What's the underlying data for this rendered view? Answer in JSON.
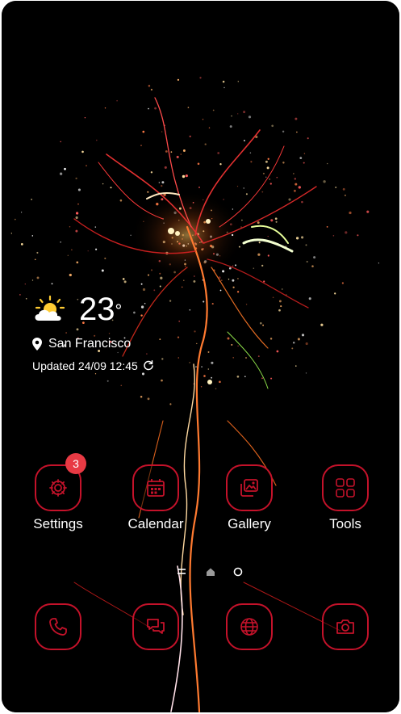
{
  "weather": {
    "temperature": "23",
    "degree_symbol": "°",
    "location": "San Francisco",
    "updated": "Updated 24/09 12:45",
    "icon": "partly-sunny-icon"
  },
  "apps": [
    {
      "label": "Settings",
      "icon": "gear-icon",
      "badge": "3"
    },
    {
      "label": "Calendar",
      "icon": "calendar-icon"
    },
    {
      "label": "Gallery",
      "icon": "gallery-icon"
    },
    {
      "label": "Tools",
      "icon": "tools-folder-icon"
    }
  ],
  "dock": [
    {
      "icon": "phone-icon"
    },
    {
      "icon": "messages-icon"
    },
    {
      "icon": "browser-icon"
    },
    {
      "icon": "camera-icon"
    }
  ],
  "page_indicators": [
    "menu-indicator",
    "home-indicator",
    "page-dot-indicator"
  ],
  "colors": {
    "accent": "#c4122a",
    "badge": "#e83a44",
    "background": "#000000"
  }
}
